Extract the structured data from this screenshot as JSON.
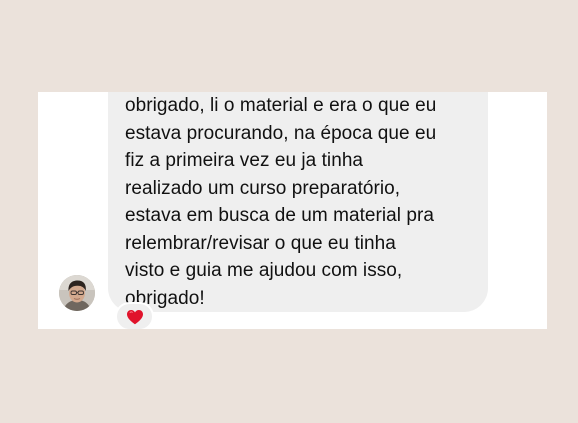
{
  "message": {
    "lines": [
      "obrigado, li o material e era o que eu",
      "estava procurando, na época que eu",
      "fiz a primeira vez eu ja tinha",
      "realizado um curso preparatório,",
      "estava em busca de um material pra",
      "relembrar/revisar o que eu tinha",
      "visto e guia me ajudou com isso,",
      "obrigado!"
    ]
  },
  "reaction": {
    "icon": "heart-icon",
    "color": "#e0132b"
  },
  "colors": {
    "background": "#ebe2db",
    "card": "#ffffff",
    "bubble": "#efefef",
    "text": "#111111"
  }
}
